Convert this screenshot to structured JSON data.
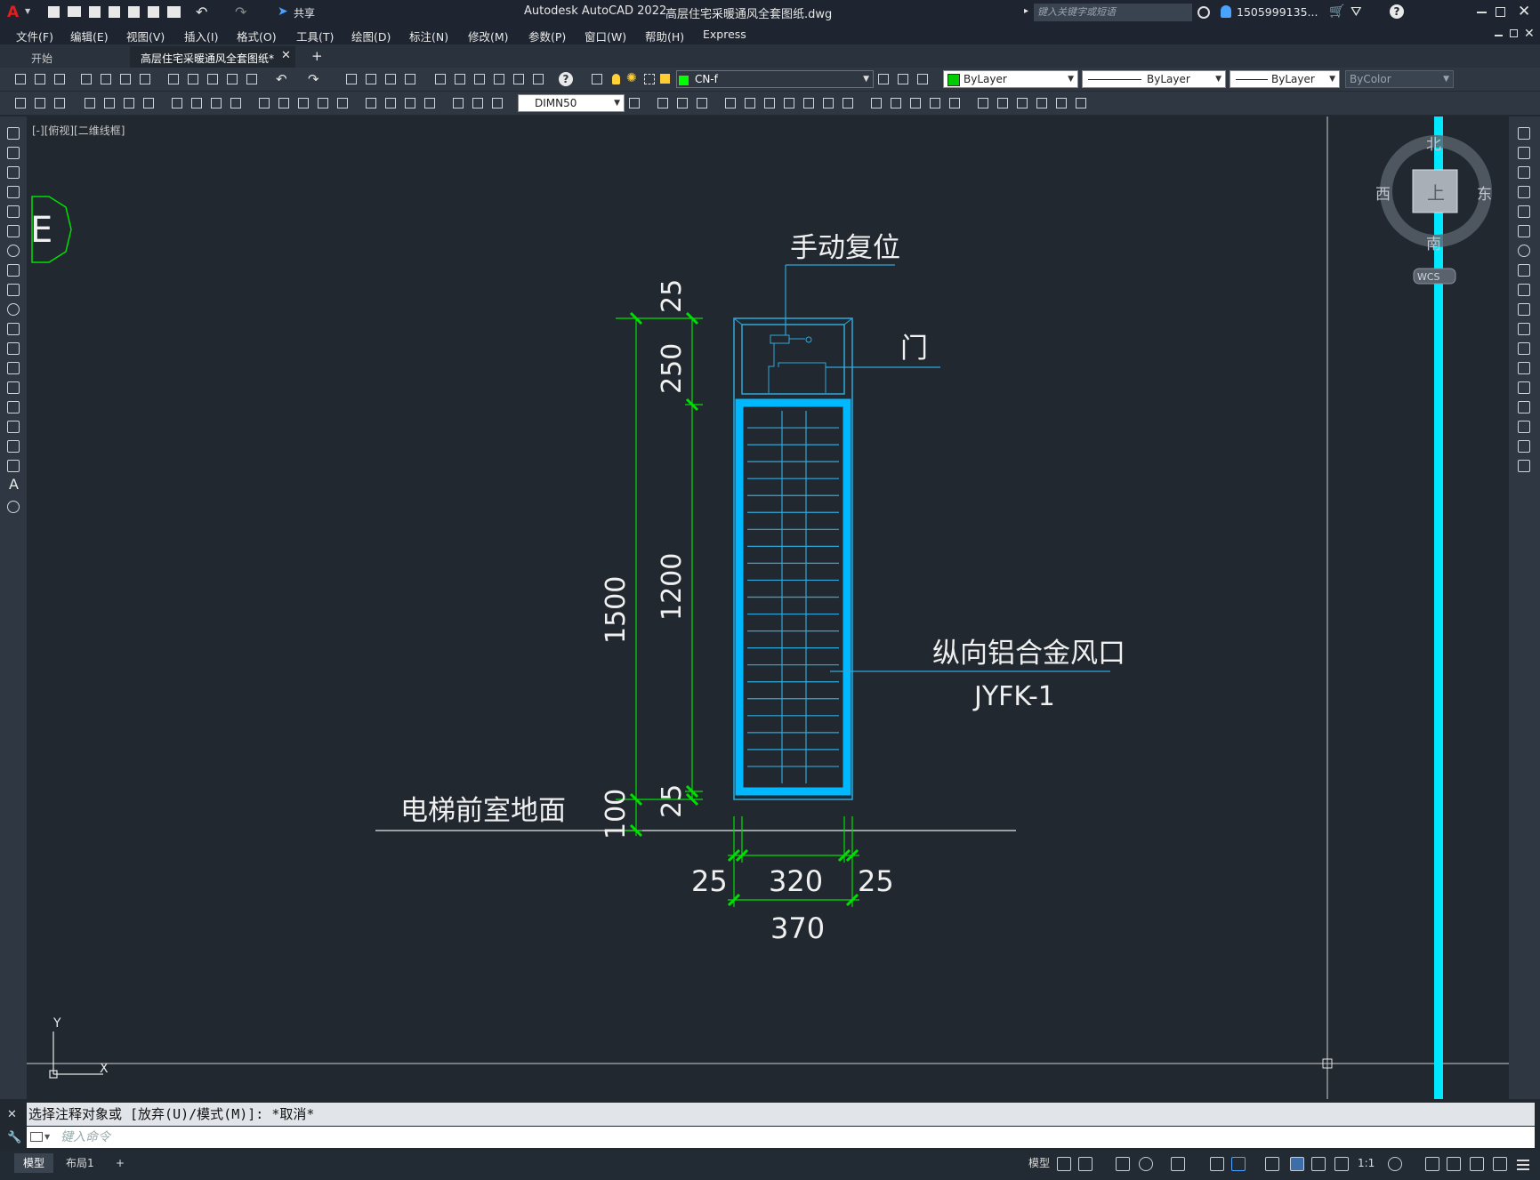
{
  "app": {
    "title": "Autodesk AutoCAD 2022",
    "document": "高层住宅采暖通风全套图纸.dwg",
    "share_label": "共享",
    "search_placeholder": "键入关键字或短语",
    "user": "1505999135..."
  },
  "menu": [
    "文件(F)",
    "编辑(E)",
    "视图(V)",
    "插入(I)",
    "格式(O)",
    "工具(T)",
    "绘图(D)",
    "标注(N)",
    "修改(M)",
    "参数(P)",
    "窗口(W)",
    "帮助(H)",
    "Express"
  ],
  "tabs": {
    "start": "开始",
    "active": "高层住宅采暖通风全套图纸*",
    "add": "+"
  },
  "toolbar": {
    "layer": "CN-f",
    "color": "ByLayer",
    "linetype": "ByLayer",
    "lineweight": "ByLayer",
    "plotstyle": "ByColor",
    "dimstyle": "DIMN50"
  },
  "viewport": {
    "label": "[-][俯视][二维线框]"
  },
  "viewcube": {
    "north": "北",
    "south": "南",
    "east": "东",
    "west": "西",
    "top": "上",
    "wcs": "WCS"
  },
  "drawing": {
    "marker": "E",
    "manual_reset": "手动复位",
    "door": "门",
    "louver_name": "纵向铝合金风口",
    "louver_code": "JYFK-1",
    "floor_label": "电梯前室地面",
    "dims": {
      "d25_top": "25",
      "d250": "250",
      "d1200": "1200",
      "d1500": "1500",
      "d25_bottom": "25",
      "d100": "100",
      "w25_left": "25",
      "w320": "320",
      "w25_right": "25",
      "w370": "370"
    },
    "ucs": {
      "x": "X",
      "y": "Y"
    }
  },
  "command": {
    "history": "选择注释对象或 [放弃(U)/模式(M)]: *取消*",
    "placeholder": "键入命令"
  },
  "status": {
    "model": "模型",
    "layout1": "布局1",
    "add": "+",
    "model_btn": "模型",
    "scale": "1:1"
  },
  "colors": {
    "accent_cyan": "#00ccff",
    "dim_green": "#00e000",
    "frame_line": "#2fa8d8",
    "cyan_line": "#00e8ff"
  }
}
